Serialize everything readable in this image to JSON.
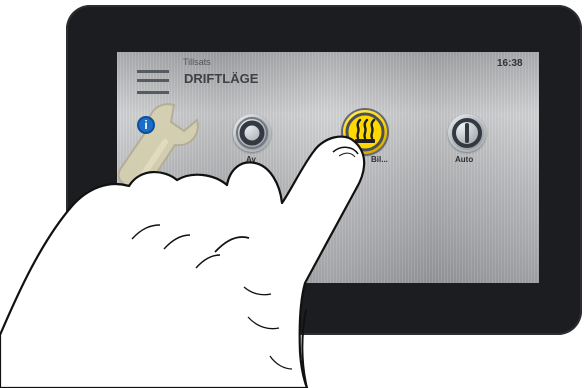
{
  "header": {
    "small_title": "Tillsats",
    "main_title": "DRIFTLÄGE",
    "time": "16:38"
  },
  "modes": [
    {
      "label": "Av"
    },
    {
      "label": "Bil..."
    },
    {
      "label": "Auto"
    }
  ],
  "icons": {
    "menu": "menu-icon",
    "info": "info-icon",
    "wrench": "wrench-icon",
    "off": "off-mode-icon",
    "heat": "heat-mode-icon",
    "auto": "auto-mode-icon",
    "hand": "hand-illustration"
  },
  "colors": {
    "device_frame": "#1c1d21",
    "screen_metal": "#c6c7ca",
    "info_blue": "#1a6ec9",
    "heat_yellow": "#ffd800",
    "text_dark": "#3e4146"
  }
}
